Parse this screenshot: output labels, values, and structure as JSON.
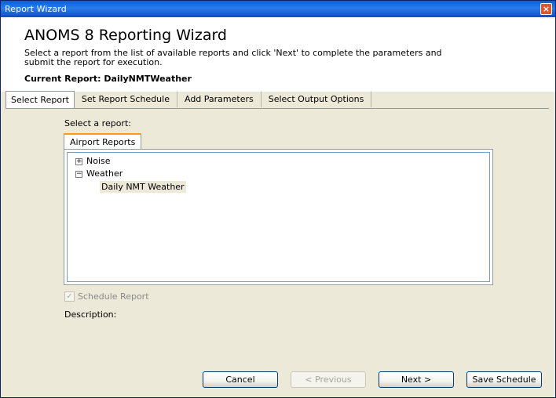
{
  "window": {
    "title": "Report Wizard",
    "close_icon": "×"
  },
  "header": {
    "title": "ANOMS 8 Reporting Wizard",
    "description": "Select a report from the list of available reports and click 'Next' to complete the parameters and submit the report for execution.",
    "current_report": "Current Report: DailyNMTWeather"
  },
  "tabs": [
    {
      "label": "Select Report",
      "active": true
    },
    {
      "label": "Set Report Schedule",
      "active": false
    },
    {
      "label": "Add Parameters",
      "active": false
    },
    {
      "label": "Select Output Options",
      "active": false
    }
  ],
  "main": {
    "select_label": "Select a report:",
    "subtab_label": "Airport Reports",
    "tree": [
      {
        "label": "Noise",
        "expanded": false
      },
      {
        "label": "Weather",
        "expanded": true,
        "children": [
          {
            "label": "Daily NMT Weather",
            "selected": true
          }
        ]
      }
    ],
    "schedule_checkbox": {
      "label": "Schedule Report",
      "checked": true,
      "enabled": false
    },
    "description_label": "Description:"
  },
  "buttons": {
    "cancel": "Cancel",
    "previous": "< Previous",
    "next": "Next >",
    "save_schedule": "Save Schedule"
  },
  "colors": {
    "titlebar": "#0a5fd8",
    "tab_highlight": "#ff9d0c",
    "dialog_bg": "#ece9d8"
  }
}
